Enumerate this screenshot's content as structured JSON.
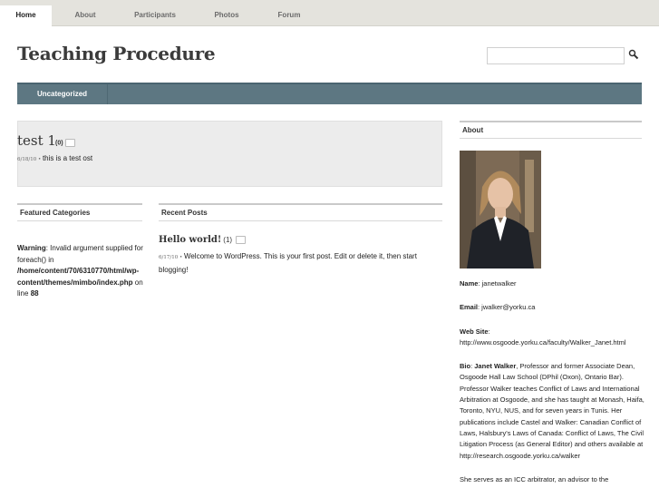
{
  "nav": {
    "tabs": [
      {
        "label": "Home",
        "active": true
      },
      {
        "label": "About",
        "active": false
      },
      {
        "label": "Participants",
        "active": false
      },
      {
        "label": "Photos",
        "active": false
      },
      {
        "label": "Forum",
        "active": false
      }
    ]
  },
  "site": {
    "title": "Teaching Procedure",
    "search_icon": "magnifier-icon"
  },
  "category_bar": {
    "items": [
      "Uncategorized"
    ]
  },
  "post": {
    "title": "test 1",
    "comments": "(0)",
    "date": "6/18/10",
    "separator": " • ",
    "excerpt": "this is a test ost"
  },
  "featured": {
    "heading": "Featured Categories",
    "warning_label": "Warning",
    "warning_text": ": Invalid argument supplied for foreach() in ",
    "warning_path": "/home/content/70/6310770/html/wp-content/themes/mimbo/index.php",
    "warning_suffix": " on line ",
    "warning_line": "88"
  },
  "recent": {
    "heading": "Recent Posts",
    "title": "Hello world!",
    "comments": "(1)",
    "date": "6/17/10",
    "separator": " • ",
    "excerpt": "Welcome to WordPress. This is your first post. Edit or delete it, then start blogging!"
  },
  "about": {
    "heading": "About",
    "name_label": "Name",
    "name_value": ": janetwalker",
    "email_label": "Email",
    "email_value": ": jwalker@yorku.ca",
    "website_label": "Web Site",
    "website_sep": ":",
    "website_value": "http://www.osgoode.yorku.ca/faculty/Walker_Janet.html",
    "bio_label": "Bio",
    "bio_sep": ": ",
    "bio_name": "Janet Walker",
    "bio_text": ", Professor and former Associate Dean, Osgoode Hall Law School (DPhil (Oxon), Ontario Bar). Professor Walker teaches Conflict of Laws and International Arbitration at Osgoode, and she has taught at Monash, Haifa, Toronto, NYU, NUS, and for seven years in Tunis. Her publications include Castel and Walker: Canadian Conflict of Laws, Halsbury's Laws of Canada: Conflict of Laws, The Civil Litigation Process (as General Editor) and others available at http://research.osgoode.yorku.ca/walker",
    "more_text": "She serves as an ICC arbitrator, an advisor to the"
  },
  "colors": {
    "nav_bg": "#e4e3dd",
    "cat_bar": "#5d7782",
    "post_bg": "#ececec"
  }
}
